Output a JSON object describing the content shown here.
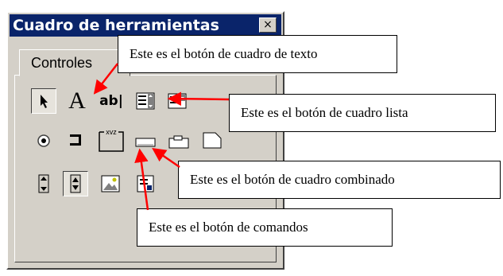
{
  "window": {
    "title": "Cuadro de herramientas",
    "close_symbol": "×"
  },
  "tab": {
    "label": "Controles"
  },
  "tools": {
    "label_tool": "A",
    "textbox_tool": "ab|",
    "frame_tool": "xvz"
  },
  "callouts": {
    "textbox": "Este es el botón de cuadro de texto",
    "listbox": "Este es el botón de cuadro lista",
    "combobox": "Este es el botón de cuadro combinado",
    "command": "Este es el botón de comandos"
  },
  "colors": {
    "titlebar": "#0a246a",
    "face": "#d4d0c8",
    "arrow": "#ff0000"
  }
}
